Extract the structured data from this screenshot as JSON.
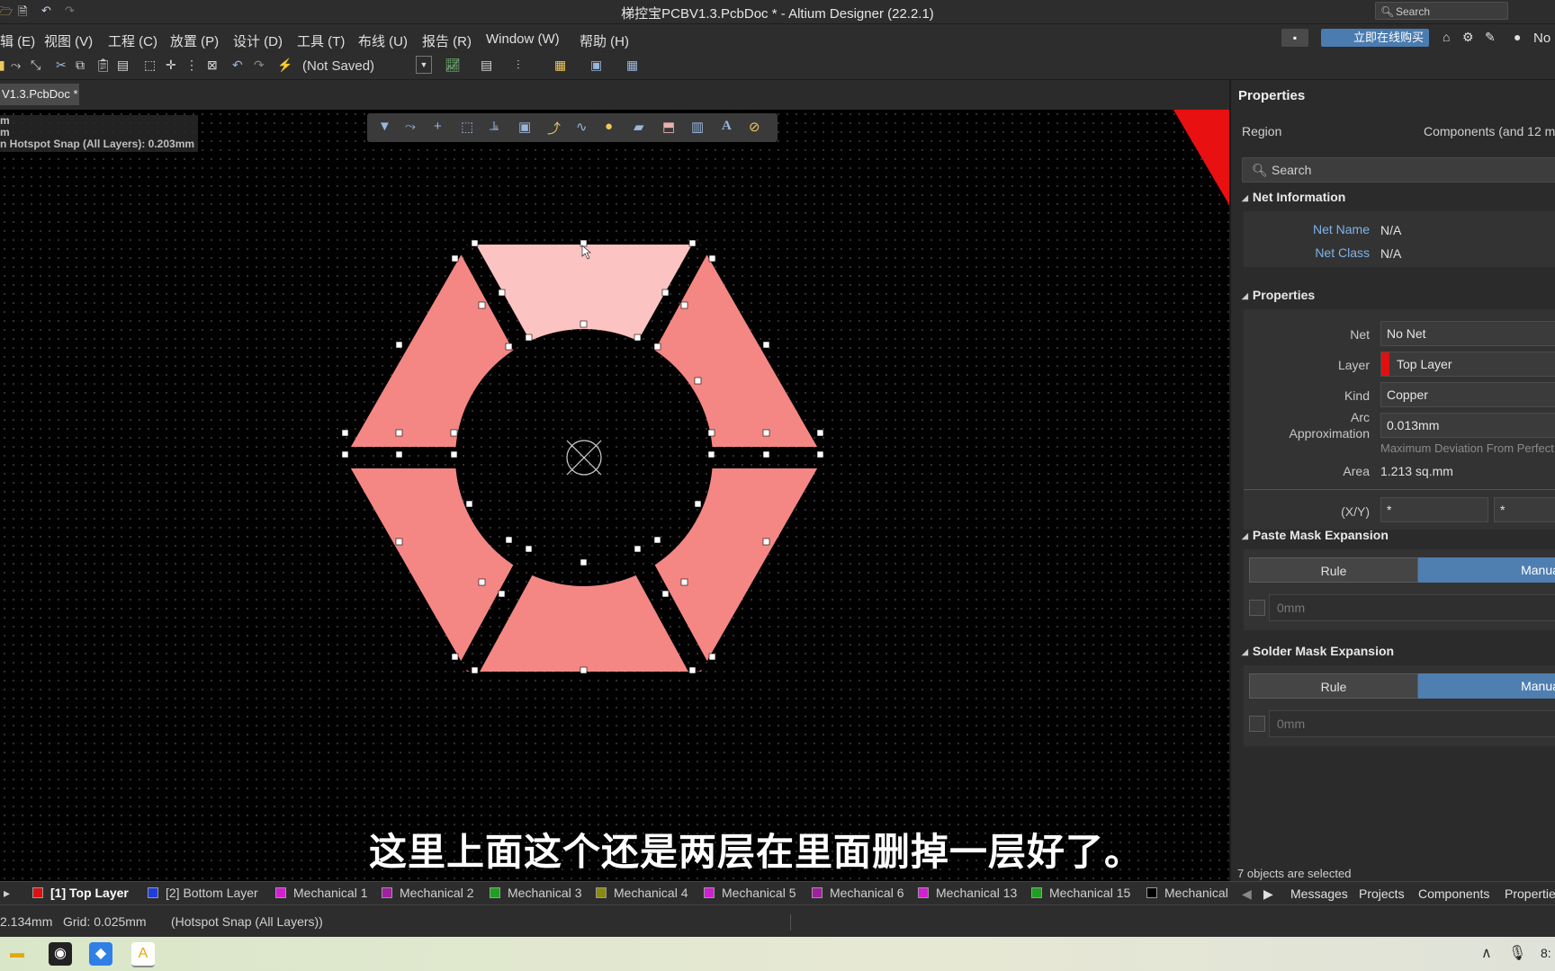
{
  "app": {
    "title": "梯控宝PCBV1.3.PcbDoc * - Altium Designer (22.2.1)",
    "search_label": "Search"
  },
  "menu": {
    "items": [
      "辑 (E)",
      "视图 (V)",
      "工程 (C)",
      "放置 (P)",
      "设计 (D)",
      "工具 (T)",
      "布线 (U)",
      "报告 (R)",
      "Window (W)",
      "帮助 (H)"
    ],
    "buy_label": "立即在线购买",
    "user_label": "No"
  },
  "toolbar": {
    "not_saved": "(Not Saved)"
  },
  "document": {
    "tab_label": "V1.3.PcbDoc *"
  },
  "hud": {
    "line1": "m",
    "line2": "m",
    "line3": "n Hotspot Snap (All Layers): 0.203mm"
  },
  "subtitle": "这里上面这个还是两层在里面删掉一层好了。",
  "colors": {
    "region_fill": "#f08080",
    "region_selected": "#f8bcbc",
    "canvas": "#000000",
    "accent": "#4f7eb0",
    "top_layer": "#e01010"
  },
  "layers": [
    {
      "label": "[1] Top Layer",
      "color": "#e01010",
      "active": true
    },
    {
      "label": "[2] Bottom Layer",
      "color": "#1f3de0",
      "active": false
    },
    {
      "label": "Mechanical 1",
      "color": "#d020d0",
      "active": false
    },
    {
      "label": "Mechanical 2",
      "color": "#a020a0",
      "active": false
    },
    {
      "label": "Mechanical 3",
      "color": "#20a020",
      "active": false
    },
    {
      "label": "Mechanical 4",
      "color": "#8a8a10",
      "active": false
    },
    {
      "label": "Mechanical 5",
      "color": "#d020d0",
      "active": false
    },
    {
      "label": "Mechanical 6",
      "color": "#a020a0",
      "active": false
    },
    {
      "label": "Mechanical 13",
      "color": "#d020d0",
      "active": false
    },
    {
      "label": "Mechanical 15",
      "color": "#20a020",
      "active": false
    },
    {
      "label": "Mechanical",
      "color": "#000000",
      "active": false
    }
  ],
  "bottom_panels": [
    "Messages",
    "Projects",
    "Components",
    "Propertie"
  ],
  "status": {
    "coords": "2.134mm",
    "grid": "Grid: 0.025mm",
    "snap": "(Hotspot Snap (All Layers))"
  },
  "properties": {
    "title": "Properties",
    "region_label": "Region",
    "region_value": "Components (and 12 m",
    "search_placeholder": "Search",
    "net_info": {
      "header": "Net Information",
      "net_name_label": "Net Name",
      "net_name_value": "N/A",
      "net_class_label": "Net Class",
      "net_class_value": "N/A"
    },
    "props": {
      "header": "Properties",
      "net_label": "Net",
      "net_value": "No Net",
      "layer_label": "Layer",
      "layer_value": "Top Layer",
      "kind_label": "Kind",
      "kind_value": "Copper",
      "arc_label_1": "Arc",
      "arc_label_2": "Approximation",
      "arc_value": "0.013mm",
      "arc_hint": "Maximum Deviation From Perfect",
      "area_label": "Area",
      "area_value": "1.213 sq.mm",
      "xy_label": "(X/Y)",
      "x_value": "*",
      "y_value": "*"
    },
    "paste": {
      "header": "Paste Mask Expansion",
      "rule": "Rule",
      "manual": "Manual",
      "value": "0mm"
    },
    "solder": {
      "header": "Solder Mask Expansion",
      "rule": "Rule",
      "manual": "Manual",
      "value": "0mm"
    },
    "selection": "7 objects are selected"
  },
  "taskbar": {
    "clock": "8:"
  }
}
